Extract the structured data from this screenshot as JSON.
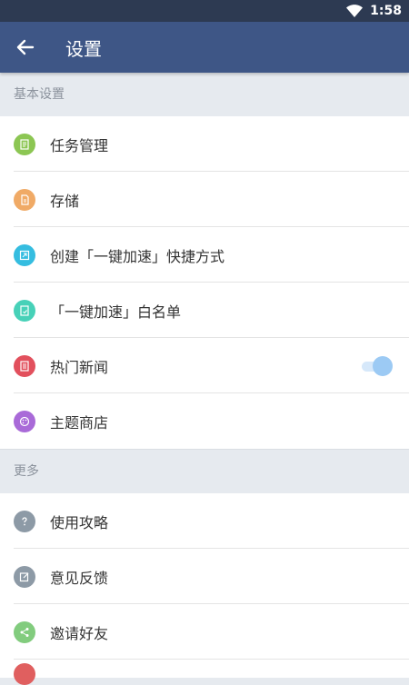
{
  "status_bar": {
    "time": "1:58"
  },
  "app_bar": {
    "title": "设置"
  },
  "sections": {
    "basic": {
      "header": "基本设置",
      "items": [
        {
          "label": "任务管理",
          "color": "#8cc653",
          "icon": "task-list-icon"
        },
        {
          "label": "存储",
          "color": "#f0aa66",
          "icon": "storage-icon"
        },
        {
          "label": "创建「一键加速」快捷方式",
          "color": "#35bde0",
          "icon": "shortcut-icon"
        },
        {
          "label": "「一键加速」白名单",
          "color": "#47d1b8",
          "icon": "whitelist-icon"
        },
        {
          "label": "热门新闻",
          "color": "#e2505d",
          "icon": "news-icon",
          "toggle_on": true
        },
        {
          "label": "主题商店",
          "color": "#a96ad8",
          "icon": "palette-icon"
        }
      ]
    },
    "more": {
      "header": "更多",
      "items": [
        {
          "label": "使用攻略",
          "color": "#8d9aa6",
          "icon": "help-icon"
        },
        {
          "label": "意见反馈",
          "color": "#8d9aa6",
          "icon": "feedback-icon"
        },
        {
          "label": "邀请好友",
          "color": "#82cc7e",
          "icon": "share-icon"
        }
      ]
    }
  }
}
